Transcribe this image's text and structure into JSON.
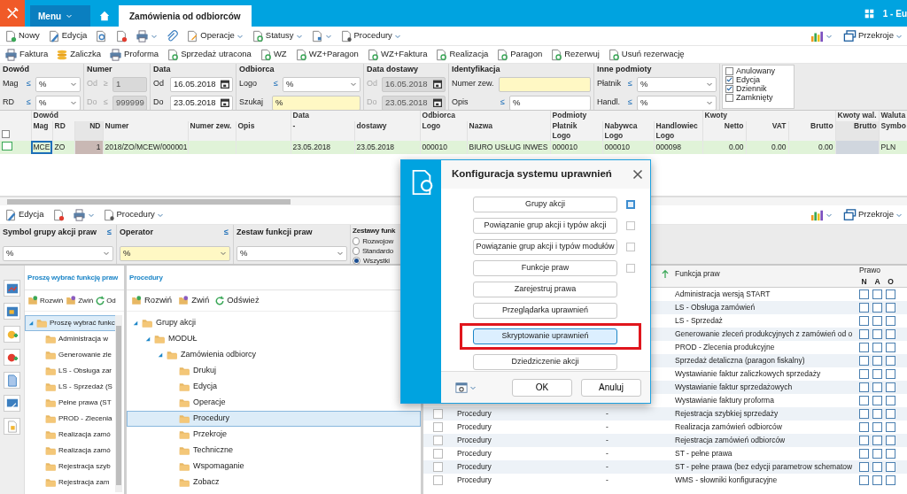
{
  "top_bar": {
    "menu_label": "Menu",
    "tabs": [
      {
        "label": "Zamówienia od odbiorców",
        "selected": true
      }
    ],
    "company": "1 - Eu"
  },
  "toolbar": [
    {
      "label": "Nowy",
      "dropdown": false
    },
    {
      "label": "Edycja",
      "dropdown": false
    },
    {
      "dropdown": false
    },
    {
      "dropdown": false
    },
    {
      "dropdown": true
    },
    {
      "dropdown": false
    },
    {
      "label": "Operacje",
      "dropdown": true
    },
    {
      "label": "Statusy",
      "dropdown": true
    },
    {
      "dropdown": true
    },
    {
      "label": "Procedury",
      "dropdown": true
    }
  ],
  "toolbar_right": [
    {
      "dropdown": true
    },
    {
      "label": "Przekroje",
      "dropdown": true
    }
  ],
  "actions": [
    "Faktura",
    "Zaliczka",
    "Proforma",
    "Sprzedaż utracona",
    "WZ",
    "WZ+Paragon",
    "WZ+Faktura",
    "Realizacja",
    "Paragon",
    "Rezerwuj",
    "Usuń rezerwację"
  ],
  "filters": [
    {
      "title": "Dowód",
      "rows": [
        {
          "label": "Mag",
          "op": "≤",
          "disabled": false,
          "field": {
            "kind": "select",
            "value": "%",
            "highlighted": false
          }
        },
        {
          "label": "RD",
          "op": "≤",
          "disabled": false,
          "field": {
            "kind": "select",
            "value": "%",
            "highlighted": false
          }
        }
      ]
    },
    {
      "title": "Numer",
      "rows": [
        {
          "label": "Od",
          "op": "≥",
          "disabled": true,
          "field": {
            "kind": "text",
            "value": "1",
            "highlighted": false
          }
        },
        {
          "label": "Do",
          "op": "≤",
          "disabled": true,
          "field": {
            "kind": "text",
            "value": "999999",
            "highlighted": false
          }
        }
      ]
    },
    {
      "title": "Data",
      "rows": [
        {
          "label": "Od",
          "disabled": false,
          "field": {
            "kind": "date",
            "value": "16.05.2018",
            "highlighted": false
          }
        },
        {
          "label": "Do",
          "disabled": false,
          "field": {
            "kind": "date",
            "value": "23.05.2018",
            "highlighted": false
          }
        }
      ]
    },
    {
      "title": "Odbiorca",
      "rows": [
        {
          "label": "Logo",
          "op": "≤",
          "disabled": false,
          "field": {
            "kind": "select",
            "value": "%",
            "highlighted": false
          }
        },
        {
          "label": "Szukaj",
          "disabled": false,
          "field": {
            "kind": "text",
            "value": "%",
            "highlighted": true
          }
        }
      ]
    },
    {
      "title": "Data dostawy",
      "rows": [
        {
          "label": "Od",
          "disabled": true,
          "field": {
            "kind": "date",
            "value": "16.05.2018",
            "highlighted": false
          }
        },
        {
          "label": "Do",
          "disabled": true,
          "field": {
            "kind": "date",
            "value": "23.05.2018",
            "highlighted": false
          }
        }
      ]
    },
    {
      "title": "Identyfikacja",
      "rows": [
        {
          "label": "Numer zew.",
          "disabled": false,
          "field": {
            "kind": "text",
            "highlighted": true
          }
        },
        {
          "label": "Opis",
          "op": "≤",
          "disabled": false,
          "field": {
            "kind": "text",
            "value": "%",
            "highlighted": false
          }
        }
      ]
    },
    {
      "title": "Inne podmioty",
      "rows": [
        {
          "label": "Płatnik",
          "op": "≤",
          "disabled": false,
          "field": {
            "kind": "select",
            "value": "%",
            "highlighted": false
          }
        },
        {
          "label": "Handl.",
          "op": "≤",
          "disabled": false,
          "field": {
            "kind": "select",
            "value": "%",
            "highlighted": false
          }
        }
      ]
    }
  ],
  "status_filters": [
    {
      "label": "Anulowany",
      "checked": false
    },
    {
      "label": "Edycja",
      "checked": true
    },
    {
      "label": "Dziennik",
      "checked": true
    },
    {
      "label": "Zamknięty",
      "checked": false
    }
  ],
  "grid": {
    "select_all_checked": false,
    "column_groups": [
      {
        "label": "Dowód",
        "columns": [
          {
            "label": "Mag",
            "numeric": false,
            "shaded": false
          },
          {
            "label": "RD",
            "numeric": false,
            "shaded": false
          },
          {
            "label": "ND",
            "numeric": true,
            "shaded": true
          },
          {
            "label": "Numer",
            "numeric": false,
            "shaded": false
          },
          {
            "label": "Numer zew.",
            "numeric": false,
            "shaded": false
          },
          {
            "label": "Opis",
            "numeric": false,
            "shaded": false
          }
        ]
      },
      {
        "label": "Data",
        "columns": [
          {
            "label": "-",
            "numeric": false,
            "shaded": false
          },
          {
            "label": "dostawy",
            "numeric": false,
            "shaded": false
          }
        ]
      },
      {
        "label": "Odbiorca",
        "columns": [
          {
            "label": "Logo",
            "numeric": false,
            "shaded": false
          },
          {
            "label": "Nazwa",
            "numeric": false,
            "shaded": false
          }
        ]
      },
      {
        "label": "Podmioty",
        "columns": [
          {
            "label": "Płatnik",
            "sublabel": "Logo",
            "numeric": false,
            "shaded": false
          },
          {
            "label": "Nabywca",
            "sublabel": "Logo",
            "numeric": false,
            "shaded": false
          },
          {
            "label": "Handlowiec",
            "sublabel": "Logo",
            "numeric": false,
            "shaded": false
          }
        ]
      },
      {
        "label": "Kwoty",
        "columns": [
          {
            "label": "Netto",
            "numeric": true,
            "shaded": false
          },
          {
            "label": "VAT",
            "numeric": true,
            "shaded": false
          },
          {
            "label": "Brutto",
            "numeric": true,
            "shaded": false
          }
        ]
      },
      {
        "label": "Kwoty wal.",
        "columns": [
          {
            "label": "Brutto",
            "numeric": true,
            "shaded": true
          }
        ]
      },
      {
        "label": "Waluta",
        "columns": [
          {
            "label": "Symbo",
            "numeric": false,
            "shaded": false
          }
        ]
      }
    ],
    "rows": [
      {
        "selected": true,
        "cells": [
          "MCE",
          "ZO",
          "1",
          "2018/ZO/MCEW/000001",
          null,
          null,
          "23.05.2018",
          "23.05.2018",
          "000010",
          "BIURO USŁUG INWES",
          "000010",
          "000010",
          "000098",
          "0.00",
          "0.00",
          "0.00",
          null,
          "PLN"
        ]
      }
    ]
  },
  "lower_toolbar": [
    {
      "label": "Edycja",
      "dropdown": false
    },
    {
      "dropdown": false
    },
    {
      "dropdown": true
    },
    {
      "label": "Procedury",
      "dropdown": true
    }
  ],
  "lower_toolbar_right": [
    {
      "dropdown": true
    },
    {
      "label": "Przekroje",
      "dropdown": true
    }
  ],
  "lower_filters": [
    {
      "label": "Symbol grupy akcji praw",
      "op": "≤",
      "value": "%",
      "highlighted": false
    },
    {
      "label": "Operator",
      "op": "≤",
      "value": "%",
      "highlighted": true
    },
    {
      "label": "Zestaw funkcji praw",
      "value": "%",
      "highlighted": false
    }
  ],
  "radio_group": {
    "title": "Zestawy funk",
    "options": [
      {
        "label": "Rozwojow",
        "selected": false
      },
      {
        "label": "Standardo",
        "selected": false
      },
      {
        "label": "Wszystki",
        "selected": true
      }
    ]
  },
  "tree_left": {
    "title": "Proszę wybrać funkcję praw",
    "toolbar": [
      "Rozwiń",
      "Zwiń",
      "Od"
    ],
    "items": [
      {
        "label": "Proszę wybrać funkc",
        "selected": true,
        "expanded": true,
        "children": [
          {
            "label": "Administracja w",
            "selected": false
          },
          {
            "label": "Generowanie zle",
            "selected": false
          },
          {
            "label": "LS - Obsługa zar",
            "selected": false
          },
          {
            "label": "LS - Sprzedaż (S",
            "selected": false
          },
          {
            "label": "Pełne prawa (ST",
            "selected": false
          },
          {
            "label": "PROD - Zlecenia",
            "selected": false
          },
          {
            "label": "Realizacja zamó",
            "selected": false
          },
          {
            "label": "Realizacja zamó",
            "selected": false
          },
          {
            "label": "Rejestracja szyb",
            "selected": false
          },
          {
            "label": "Rejestracja zam",
            "selected": false
          }
        ]
      }
    ]
  },
  "tree_right": {
    "title": "Procedury",
    "toolbar": [
      "Rozwiń",
      "Zwiń",
      "Odśwież"
    ],
    "items": [
      {
        "label": "Grupy akcji",
        "selected": false,
        "expanded": true,
        "children": [
          {
            "label": "MODUŁ",
            "selected": false,
            "expanded": true,
            "children": [
              {
                "label": "Zamówienia odbiorcy",
                "selected": false,
                "expanded": true,
                "children": [
                  {
                    "label": "Drukuj",
                    "selected": false
                  },
                  {
                    "label": "Edycja",
                    "selected": false
                  },
                  {
                    "label": "Operacje",
                    "selected": false
                  },
                  {
                    "label": "Procedury",
                    "selected": true
                  },
                  {
                    "label": "Przekroje",
                    "selected": false
                  },
                  {
                    "label": "Techniczne",
                    "selected": false
                  },
                  {
                    "label": "Wspomaganie",
                    "selected": false
                  },
                  {
                    "label": "Zobacz",
                    "selected": false
                  }
                ]
              }
            ]
          }
        ]
      }
    ]
  },
  "rights_table": {
    "function_header": "Funkcja praw",
    "right_header": "Prawo",
    "flags": [
      "N",
      "A",
      "O"
    ],
    "rows": [
      {
        "funkcja": "Administracja wersją START",
        "flags": [
          false,
          false,
          false
        ]
      },
      {
        "funkcja": "LS - Obsługa zamówień",
        "flags": [
          false,
          false,
          false
        ]
      },
      {
        "funkcja": "LS - Sprzedaż",
        "flags": [
          false,
          false,
          false
        ]
      },
      {
        "funkcja": "Generowanie zleceń produkcyjnych z zamówień od o",
        "flags": [
          false,
          false,
          false
        ]
      },
      {
        "funkcja": "PROD - Zlecenia produkcyjne",
        "flags": [
          false,
          false,
          false
        ]
      },
      {
        "funkcja": "Sprzedaż detaliczna (paragon fiskalny)",
        "flags": [
          false,
          false,
          false
        ]
      },
      {
        "funkcja": "Wystawianie faktur zaliczkowych sprzedaży",
        "flags": [
          false,
          false,
          false
        ]
      },
      {
        "funkcja": "Wystawianie faktur sprzedażowych",
        "flags": [
          false,
          false,
          false
        ]
      },
      {
        "funkcja": "Wystawianie faktury proforma",
        "flags": [
          false,
          false,
          false
        ]
      },
      {
        "checked": false,
        "group": "Procedury",
        "dash": "-",
        "funkcja": "Rejestracja szybkiej sprzedaży",
        "flags": [
          false,
          false,
          false
        ]
      },
      {
        "checked": false,
        "group": "Procedury",
        "dash": "-",
        "funkcja": "Realizacja zamówień odbiorców",
        "flags": [
          false,
          false,
          false
        ]
      },
      {
        "checked": false,
        "group": "Procedury",
        "dash": "-",
        "funkcja": "Rejestracja zamówień odbiorców",
        "flags": [
          false,
          false,
          false
        ]
      },
      {
        "checked": false,
        "group": "Procedury",
        "dash": "-",
        "funkcja": "ST - pełne prawa",
        "flags": [
          false,
          false,
          false
        ]
      },
      {
        "checked": false,
        "group": "Procedury",
        "dash": "-",
        "funkcja": "ST - pełne prawa (bez edycji parametrow schematow",
        "flags": [
          false,
          false,
          false
        ]
      },
      {
        "checked": false,
        "group": "Procedury",
        "dash": "-",
        "funkcja": "WMS - słowniki konfiguracyjne",
        "flags": [
          false,
          false,
          false
        ]
      }
    ]
  },
  "dialog": {
    "title": "Konfiguracja systemu uprawnień",
    "buttons": [
      {
        "label": "Grupy akcji",
        "selected": false,
        "checkbox": {
          "checked": false,
          "focused": true
        }
      },
      {
        "label": "Powiązanie grup akcji i typów akcji",
        "selected": false,
        "checkbox": {
          "checked": false,
          "focused": false
        }
      },
      {
        "label": "Powiązanie grup akcji i typów modułów",
        "selected": false,
        "checkbox": {
          "checked": false,
          "focused": false
        }
      },
      {
        "label": "Funkcje praw",
        "selected": false,
        "checkbox": {
          "checked": false,
          "focused": false
        }
      },
      {
        "label": "Zarejestruj prawa",
        "selected": false
      },
      {
        "label": "Przeglądarka uprawnień",
        "selected": false
      },
      {
        "label": "Skryptowanie uprawnień",
        "selected": true
      },
      {
        "label": "Dziedziczenie akcji",
        "selected": false
      }
    ],
    "ok": "OK",
    "cancel": "Anuluj"
  }
}
